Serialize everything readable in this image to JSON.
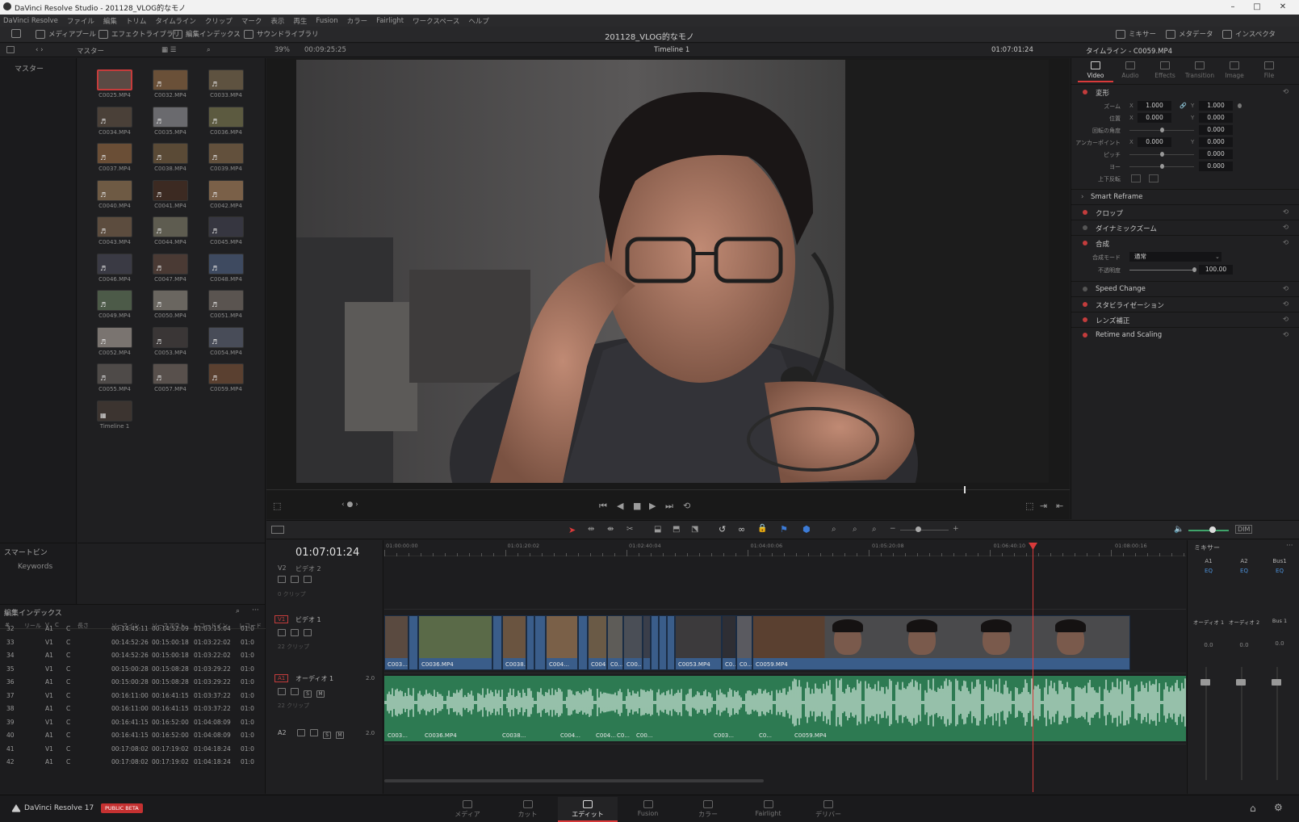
{
  "window": {
    "title": "DaVinci Resolve Studio - 201128_VLOG的なモノ",
    "controls": [
      "–",
      "□",
      "✕"
    ]
  },
  "menu": [
    "DaVinci Resolve",
    "ファイル",
    "編集",
    "トリム",
    "タイムライン",
    "クリップ",
    "マーク",
    "表示",
    "再生",
    "Fusion",
    "カラー",
    "Fairlight",
    "ワークスペース",
    "ヘルプ"
  ],
  "toolbar": {
    "media_pool": "メディアプール",
    "effects_library": "エフェクトライブラリ",
    "edit_index": "編集インデックス",
    "sound_library": "サウンドライブラリ",
    "project_title": "201128_VLOG的なモノ",
    "mixer": "ミキサー",
    "metadata": "メタデータ",
    "inspector": "インスペクタ"
  },
  "subbar": {
    "bin_path": "マスター",
    "zoom": "39%",
    "source_duration": "00:09:25:25",
    "timeline_name": "Timeline 1",
    "record_timecode": "01:07:01:24",
    "inspector_target": "タイムライン - C0059.MP4"
  },
  "bins": {
    "master": "マスター",
    "smart_bins": "スマートビン",
    "keywords": "Keywords"
  },
  "media_pool": [
    {
      "name": "C0025.MP4",
      "color": "#5a4a44",
      "selected": true
    },
    {
      "name": "C0032.MP4",
      "color": "#6a5038",
      "note": "♬"
    },
    {
      "name": "C0033.MP4",
      "color": "#5e5240",
      "note": "♬"
    },
    {
      "name": "C0034.MP4",
      "color": "#4a4038",
      "note": "♬"
    },
    {
      "name": "C0035.MP4",
      "color": "#6a6a6e",
      "note": "♬"
    },
    {
      "name": "C0036.MP4",
      "color": "#5c5a40",
      "note": "♬"
    },
    {
      "name": "C0037.MP4",
      "color": "#6a4e36",
      "note": "♬"
    },
    {
      "name": "C0038.MP4",
      "color": "#5a4a36",
      "note": "♬"
    },
    {
      "name": "C0039.MP4",
      "color": "#62503c",
      "note": "♬"
    },
    {
      "name": "C0040.MP4",
      "color": "#6e5a44",
      "note": "♬"
    },
    {
      "name": "C0041.MP4",
      "color": "#3c2a22",
      "note": "♬"
    },
    {
      "name": "C0042.MP4",
      "color": "#7a6048",
      "note": "♬"
    },
    {
      "name": "C0043.MP4",
      "color": "#5c4c3e",
      "note": "♬"
    },
    {
      "name": "C0044.MP4",
      "color": "#5e5c50",
      "note": "♬"
    },
    {
      "name": "C0045.MP4",
      "color": "#363640",
      "note": "♬"
    },
    {
      "name": "C0046.MP4",
      "color": "#3a3a44",
      "note": "♬"
    },
    {
      "name": "C0047.MP4",
      "color": "#4a3a34",
      "note": "♬"
    },
    {
      "name": "C0048.MP4",
      "color": "#3e4a60",
      "note": "♬"
    },
    {
      "name": "C0049.MP4",
      "color": "#4c5a48",
      "note": "♬"
    },
    {
      "name": "C0050.MP4",
      "color": "#6a6660",
      "note": "♬"
    },
    {
      "name": "C0051.MP4",
      "color": "#5a5450",
      "note": "♬"
    },
    {
      "name": "C0052.MP4",
      "color": "#7a7470",
      "note": "♬"
    },
    {
      "name": "C0053.MP4",
      "color": "#3a3636",
      "note": "♬"
    },
    {
      "name": "C0054.MP4",
      "color": "#484c58",
      "note": "♬"
    },
    {
      "name": "C0055.MP4",
      "color": "#4e4a48",
      "note": "♬"
    },
    {
      "name": "C0057.MP4",
      "color": "#58504c",
      "note": "♬"
    },
    {
      "name": "C0059.MP4",
      "color": "#5a4030",
      "note": "♬"
    },
    {
      "name": "Timeline 1",
      "color": "#3c3430",
      "note": "▦"
    }
  ],
  "edit_index": {
    "title": "編集インデックス",
    "columns": [
      "#",
      "リール",
      "V",
      "C",
      "長さ",
      "ソースイン",
      "ソースアウト",
      "レコードイン",
      "レコード"
    ],
    "rows": [
      [
        "32",
        "A1",
        "C",
        "00:14:45:11",
        "00:14:52:09",
        "01:03:15:04",
        "01:0"
      ],
      [
        "33",
        "V1",
        "C",
        "00:14:52:26",
        "00:15:00:18",
        "01:03:22:02",
        "01:0"
      ],
      [
        "34",
        "A1",
        "C",
        "00:14:52:26",
        "00:15:00:18",
        "01:03:22:02",
        "01:0"
      ],
      [
        "35",
        "V1",
        "C",
        "00:15:00:28",
        "00:15:08:28",
        "01:03:29:22",
        "01:0"
      ],
      [
        "36",
        "A1",
        "C",
        "00:15:00:28",
        "00:15:08:28",
        "01:03:29:22",
        "01:0"
      ],
      [
        "37",
        "V1",
        "C",
        "00:16:11:00",
        "00:16:41:15",
        "01:03:37:22",
        "01:0"
      ],
      [
        "38",
        "A1",
        "C",
        "00:16:11:00",
        "00:16:41:15",
        "01:03:37:22",
        "01:0"
      ],
      [
        "39",
        "V1",
        "C",
        "00:16:41:15",
        "00:16:52:00",
        "01:04:08:09",
        "01:0"
      ],
      [
        "40",
        "A1",
        "C",
        "00:16:41:15",
        "00:16:52:00",
        "01:04:08:09",
        "01:0"
      ],
      [
        "41",
        "V1",
        "C",
        "00:17:08:02",
        "00:17:19:02",
        "01:04:18:24",
        "01:0"
      ],
      [
        "42",
        "A1",
        "C",
        "00:17:08:02",
        "00:17:19:02",
        "01:04:18:24",
        "01:0"
      ]
    ]
  },
  "viewer": {
    "playhead_fraction": 0.87
  },
  "inspector": {
    "tabs": [
      {
        "label": "Video",
        "active": true
      },
      {
        "label": "Audio",
        "active": false
      },
      {
        "label": "Effects",
        "active": false
      },
      {
        "label": "Transition",
        "active": false
      },
      {
        "label": "Image",
        "active": false
      },
      {
        "label": "File",
        "active": false
      }
    ],
    "transform": {
      "label": "変形",
      "zoom_label": "ズーム",
      "zoom_x": "1.000",
      "zoom_y": "1.000",
      "position_label": "位置",
      "position_x": "0.000",
      "position_y": "0.000",
      "rotation_label": "回転の角度",
      "rotation": "0.000",
      "anchor_label": "アンカーポイント",
      "anchor_x": "0.000",
      "anchor_y": "0.000",
      "pitch_label": "ピッチ",
      "pitch": "0.000",
      "yaw_label": "ヨー",
      "yaw": "0.000",
      "flip_label": "上下反転"
    },
    "sections": {
      "smart_reframe": "Smart Reframe",
      "crop": "クロップ",
      "dynamic_zoom": "ダイナミックズーム",
      "composite": "合成",
      "composite_mode_label": "合成モード",
      "composite_mode": "通常",
      "opacity_label": "不透明度",
      "opacity": "100.00",
      "speed_change": "Speed Change",
      "stabilization": "スタビライゼーション",
      "lens_correction": "レンズ補正",
      "retime_scaling": "Retime and Scaling"
    }
  },
  "timeline": {
    "timecode": "01:07:01:24",
    "ruler": [
      "01:00:00:00",
      "01:01:20:02",
      "01:02:40:04",
      "01:04:00:06",
      "01:05:20:08",
      "01:06:40:10",
      "01:08:00:16"
    ],
    "v2": {
      "id": "V2",
      "name": "ビデオ 2",
      "count": "0 クリップ"
    },
    "v1": {
      "id": "V1",
      "name": "ビデオ 1",
      "count": "22 クリップ"
    },
    "a1": {
      "id": "A1",
      "name": "オーディオ 1",
      "count": "22 クリップ",
      "format": "2.0"
    },
    "a2": {
      "id": "A2",
      "format": "2.0"
    },
    "solo": "S",
    "mute": "M",
    "video_clips": [
      {
        "name": "C003...",
        "color": "#5a4a40"
      },
      {
        "name": "",
        "color": "#3a5d8a"
      },
      {
        "name": "C0036.MP4",
        "color": "#5a6a48"
      },
      {
        "name": "",
        "color": "#3a5d8a"
      },
      {
        "name": "C0038...",
        "color": "#6a5440"
      },
      {
        "name": "",
        "color": "#3a5d8a"
      },
      {
        "name": "",
        "color": "#3a5d8a"
      },
      {
        "name": "C004...",
        "color": "#7a6048"
      },
      {
        "name": "",
        "color": "#3a5d8a"
      },
      {
        "name": "C004...",
        "color": "#6a5a46"
      },
      {
        "name": "C0...",
        "color": "#5e5c58"
      },
      {
        "name": "C00...",
        "color": "#4a4e56"
      },
      {
        "name": "",
        "color": "#3a3e4a"
      },
      {
        "name": "",
        "color": "#3a5d8a"
      },
      {
        "name": "",
        "color": "#3a5d8a"
      },
      {
        "name": "",
        "color": "#3a5d8a"
      },
      {
        "name": "C0053.MP4",
        "color": "#3c3a3c"
      },
      {
        "name": "C0...",
        "color": "#2e2e34"
      },
      {
        "name": "C0...",
        "color": "#5a5a60"
      },
      {
        "name": "C0059.MP4",
        "color": "#5a4030"
      }
    ],
    "audio_names": [
      {
        "name": "C003..."
      },
      {
        "name": "C0036.MP4"
      },
      {
        "name": "C0038..."
      },
      {
        "name": "C004..."
      },
      {
        "name": "C004..."
      },
      {
        "name": "C0..."
      },
      {
        "name": "C00..."
      },
      {
        "name": "C003..."
      },
      {
        "name": "C0..."
      },
      {
        "name": "C0059.MP4"
      }
    ]
  },
  "mixer": {
    "title": "ミキサー",
    "channels": [
      {
        "id": "A1",
        "name": "オーディオ 1",
        "eq": "EQ"
      },
      {
        "id": "A2",
        "name": "オーディオ 2",
        "eq": "EQ"
      },
      {
        "id": "Bus1",
        "name": "Bus 1",
        "eq": "EQ"
      }
    ],
    "level": "0.0"
  },
  "pages": [
    {
      "label": "メディア",
      "active": false
    },
    {
      "label": "カット",
      "active": false
    },
    {
      "label": "エディット",
      "active": true
    },
    {
      "label": "Fusion",
      "active": false
    },
    {
      "label": "カラー",
      "active": false
    },
    {
      "label": "Fairlight",
      "active": false
    },
    {
      "label": "デリバー",
      "active": false
    }
  ],
  "app": {
    "brand": "DaVinci Resolve 17",
    "badge": "PUBLIC BETA"
  },
  "colors": {
    "accent": "#d93a3a",
    "video_clip": "#3a5d8a",
    "audio_clip": "#2d7a52",
    "eq": "#4c90d8"
  }
}
